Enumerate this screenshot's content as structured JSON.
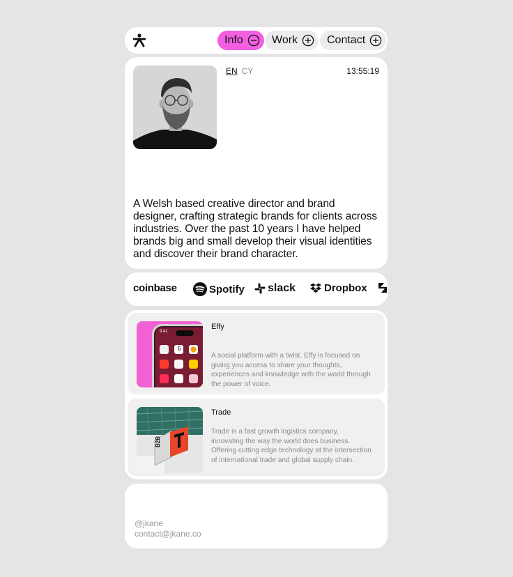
{
  "nav": {
    "items": [
      {
        "label": "Info",
        "icon": "minus-circle-icon",
        "active": true
      },
      {
        "label": "Work",
        "icon": "plus-circle-icon",
        "active": false
      },
      {
        "label": "Contact",
        "icon": "plus-circle-icon",
        "active": false
      }
    ],
    "accent": "#f25fe0"
  },
  "bio": {
    "lang_en": "EN",
    "lang_cy": "CY",
    "clock": "13:55:19",
    "text": "A Welsh based creative director and brand designer, crafting strategic brands for clients across industries. Over the past 10 years I have helped brands big and small develop their visual identities and discover their brand character."
  },
  "clients": {
    "coinbase": "coinbase",
    "spotify": "Spotify",
    "slack": "slack",
    "dropbox": "Dropbox"
  },
  "projects": [
    {
      "title": "Effy",
      "description": "A social platform with a twist. Effy is focused on giving you access to share your thoughts, experiences and knowledge with the world through the power of voice.",
      "phone_time": "9:41",
      "calendar_day": "6"
    },
    {
      "title": "Trade",
      "description": "Trade is a fast growth logistics company, innovating the way the world does business. Offering cutting edge technology at the intersection of international trade and global supply chain.",
      "sign_text": "B2B"
    }
  ],
  "footer": {
    "handle": "@jkane",
    "email": "contact@jkane.co"
  }
}
